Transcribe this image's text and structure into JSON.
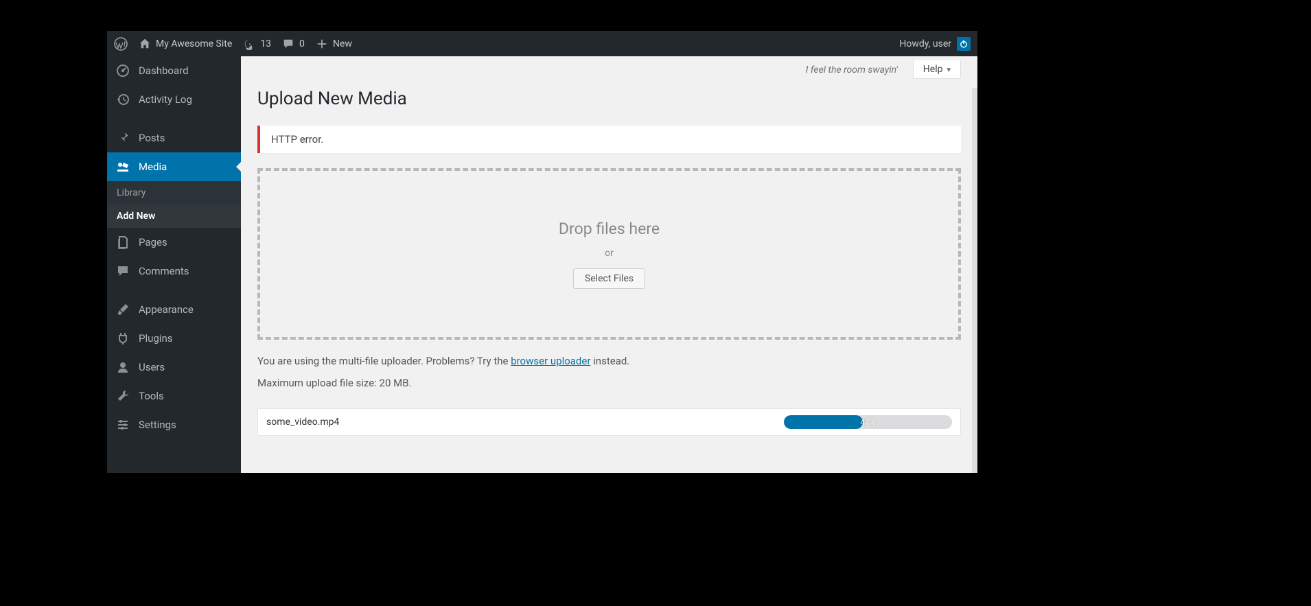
{
  "adminbar": {
    "site_name": "My Awesome Site",
    "updates_count": "13",
    "comments_count": "0",
    "new_label": "New",
    "greeting": "Howdy, user"
  },
  "menu": {
    "dashboard": "Dashboard",
    "activity_log": "Activity Log",
    "posts": "Posts",
    "media": "Media",
    "media_sub": {
      "library": "Library",
      "add_new": "Add New"
    },
    "pages": "Pages",
    "comments": "Comments",
    "appearance": "Appearance",
    "plugins": "Plugins",
    "users": "Users",
    "tools": "Tools",
    "settings": "Settings"
  },
  "screen": {
    "tagline": "I feel the room swayin'",
    "help_label": "Help"
  },
  "page": {
    "title": "Upload New Media",
    "error": "HTTP error.",
    "drop_title": "Drop files here",
    "drop_or": "or",
    "select_files": "Select Files",
    "hint_pre": "You are using the multi-file uploader. Problems? Try the ",
    "hint_link": "browser uploader",
    "hint_post": " instead.",
    "max_size": "Maximum upload file size: 20 MB."
  },
  "upload": {
    "filename": "some_video.mp4",
    "percent_label": "47%",
    "percent_value": 47
  }
}
